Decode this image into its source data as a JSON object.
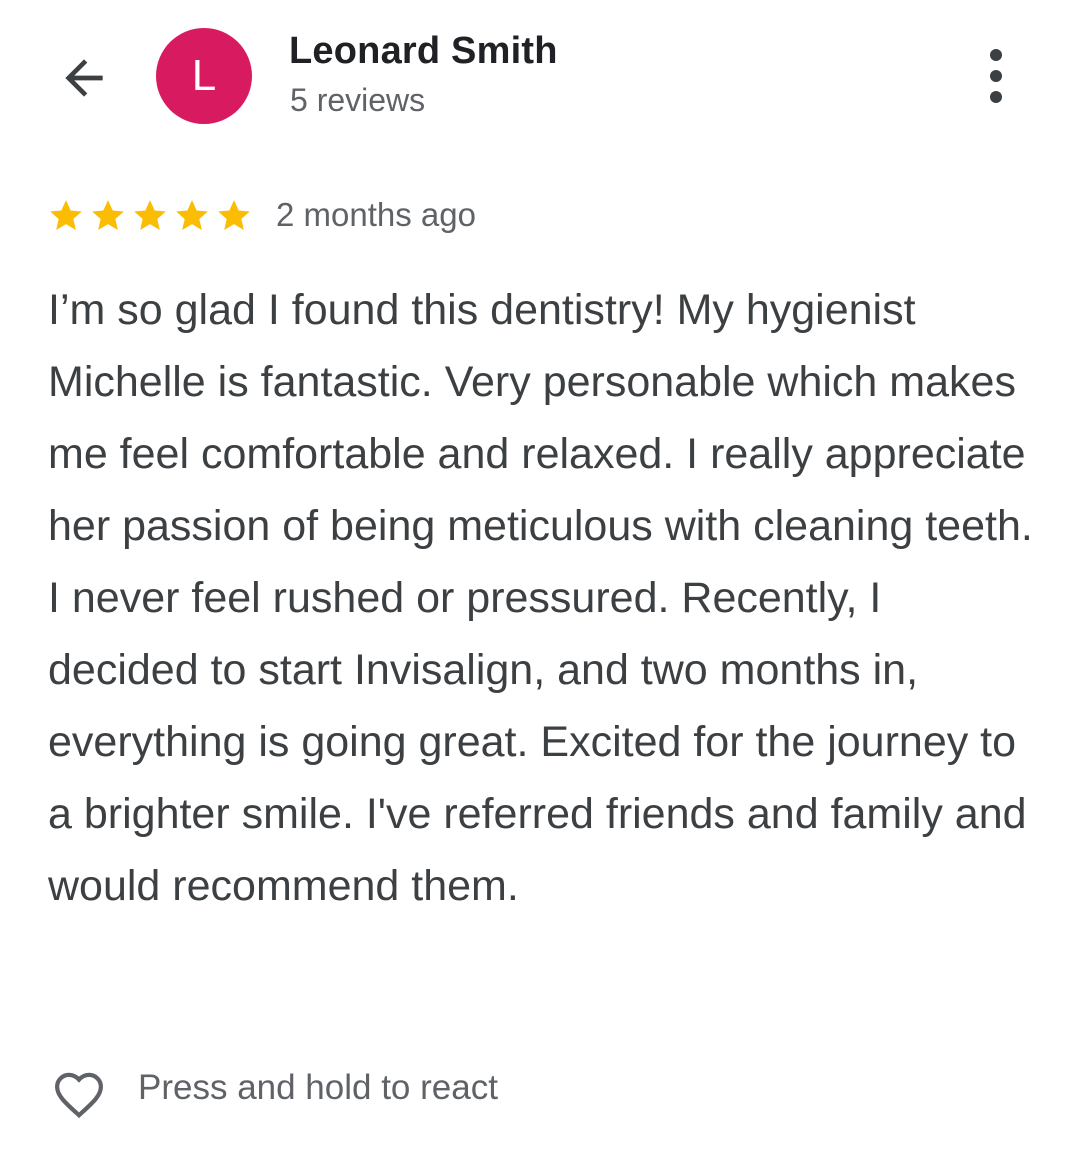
{
  "header": {
    "back_icon": "arrow-back-icon",
    "avatar_initial": "L",
    "avatar_color": "#d81b60",
    "reviewer_name": "Leonard Smith",
    "review_count": "5 reviews",
    "more_icon": "more-vertical-icon"
  },
  "review": {
    "rating": 5,
    "max_rating": 5,
    "star_color": "#fbbc04",
    "date": "2 months ago",
    "text": "I’m so glad I found this dentistry! My hygienist Michelle is fantastic. Very personable which makes me feel comfortable and relaxed. I really appreciate her passion of being meticulous with cleaning teeth. I never feel rushed or pressured. Recently, I decided to start Invisalign, and two months in, everything is going great. Excited for the journey to a brighter smile. I've referred friends and family and would recommend them."
  },
  "footer": {
    "react_icon": "heart-outline-icon",
    "react_hint": "Press and hold to react"
  }
}
